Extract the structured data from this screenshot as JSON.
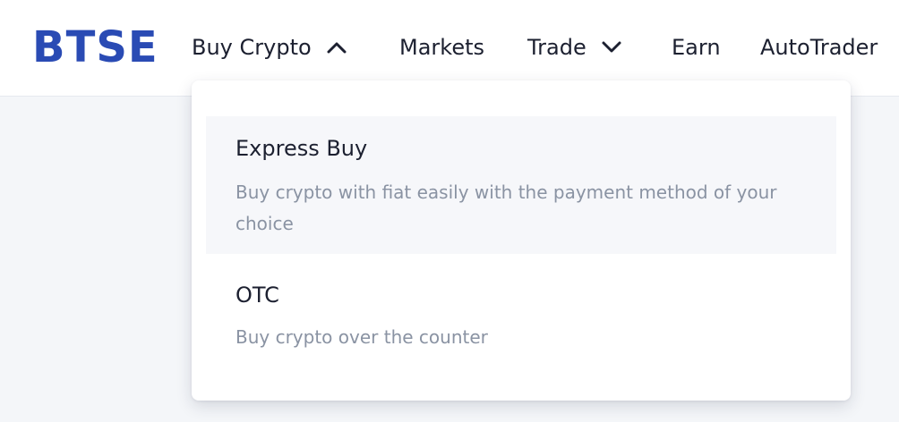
{
  "brand": {
    "logo_text": "BTSE",
    "color": "#2a4bb4"
  },
  "nav": {
    "items": [
      {
        "label": "Buy Crypto",
        "icon": "chevron-up-icon"
      },
      {
        "label": "Markets"
      },
      {
        "label": "Trade",
        "icon": "chevron-down-icon"
      },
      {
        "label": "Earn"
      },
      {
        "label": "AutoTrader"
      }
    ]
  },
  "dropdown": {
    "options": [
      {
        "title": "Express Buy",
        "description": "Buy crypto with fiat easily with the payment method of your choice"
      },
      {
        "title": "OTC",
        "description": "Buy crypto over the counter"
      }
    ]
  }
}
